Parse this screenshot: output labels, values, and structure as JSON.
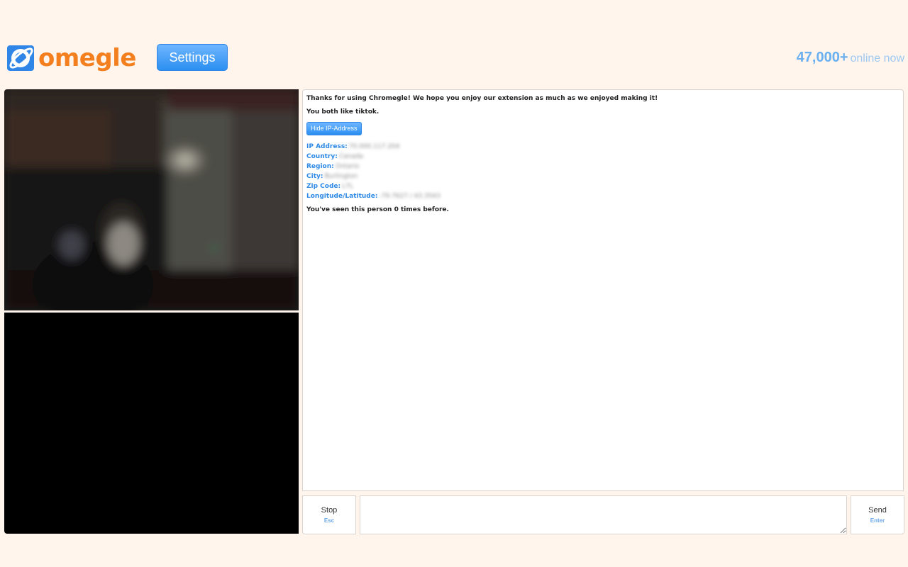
{
  "header": {
    "logo_text": "omegle",
    "settings_label": "Settings",
    "online_count": "47,000+",
    "online_label": "online now"
  },
  "chat": {
    "messages": [
      "Thanks for using Chromegle! We hope you enjoy our extension as much as we enjoyed making it!",
      "You both like tiktok."
    ],
    "hide_ip_label": "Hide IP-Address",
    "ip_info": [
      {
        "label": "IP Address:",
        "value": "70.000.117.204"
      },
      {
        "label": "Country:",
        "value": "Canada"
      },
      {
        "label": "Region:",
        "value": "Ontario"
      },
      {
        "label": "City:",
        "value": "Burlington"
      },
      {
        "label": "Zip Code:",
        "value": "L7L"
      },
      {
        "label": "Longitude/Latitude:",
        "value": "-79.7627 / 43.3543"
      }
    ],
    "seen_text": "You've seen this person 0 times before."
  },
  "controls": {
    "stop_label": "Stop",
    "stop_hint": "Esc",
    "send_label": "Send",
    "send_hint": "Enter",
    "input_value": ""
  },
  "colors": {
    "background": "#fff5ec",
    "brand_orange": "#f47f1f",
    "accent_blue": "#2e8ae6"
  }
}
